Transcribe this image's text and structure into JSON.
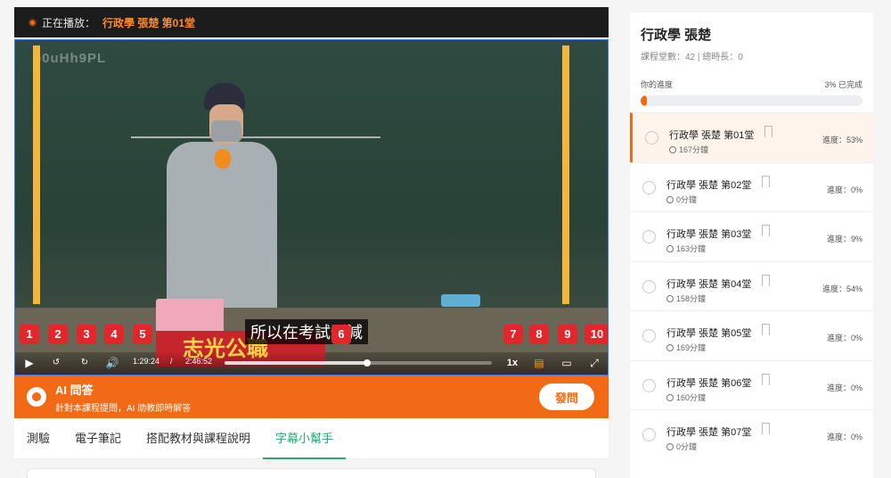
{
  "now_playing": {
    "label": "正在播放：",
    "title": "行政學 張楚 第01堂"
  },
  "video": {
    "watermark": "o0uHh9PL",
    "subtitle": "所以在考試刪減",
    "banner": "志光公職",
    "controls": {
      "current_time": "1:29:24",
      "separator": "/",
      "duration": "2:46:52",
      "speed": "1x",
      "progress_fraction": 0.535
    },
    "markers": [
      "1",
      "2",
      "3",
      "4",
      "5",
      "6",
      "7",
      "8",
      "9",
      "10"
    ]
  },
  "ai_bar": {
    "title": "AI 問答",
    "subtitle": "針對本課程提問，AI 助教即時解答",
    "button": "發問"
  },
  "tabs": [
    {
      "label": "測驗"
    },
    {
      "label": "電子筆記"
    },
    {
      "label": "搭配教材與課程說明"
    },
    {
      "label": "字幕小幫手",
      "active": true
    }
  ],
  "course": {
    "title": "行政學 張楚",
    "meta": "課程堂數：42 | 總時長：0",
    "progress_label": "你的進度",
    "progress_value": "3% 已完成",
    "progress_fraction": 0.03
  },
  "lessons": [
    {
      "title": "行政學 張楚 第01堂",
      "duration": "167分鐘",
      "progress": "進度：53%",
      "current": true
    },
    {
      "title": "行政學 張楚 第02堂",
      "duration": "0分鐘",
      "progress": "進度：0%"
    },
    {
      "title": "行政學 張楚 第03堂",
      "duration": "163分鐘",
      "progress": "進度：9%"
    },
    {
      "title": "行政學 張楚 第04堂",
      "duration": "158分鐘",
      "progress": "進度：54%"
    },
    {
      "title": "行政學 張楚 第05堂",
      "duration": "169分鐘",
      "progress": "進度：0%"
    },
    {
      "title": "行政學 張楚 第06堂",
      "duration": "160分鐘",
      "progress": "進度：0%"
    },
    {
      "title": "行政學 張楚 第07堂",
      "duration": "0分鐘",
      "progress": "進度：0%"
    }
  ],
  "colors": {
    "accent": "#f26a16",
    "tab_active": "#2aa775",
    "marker": "#e2272c"
  }
}
